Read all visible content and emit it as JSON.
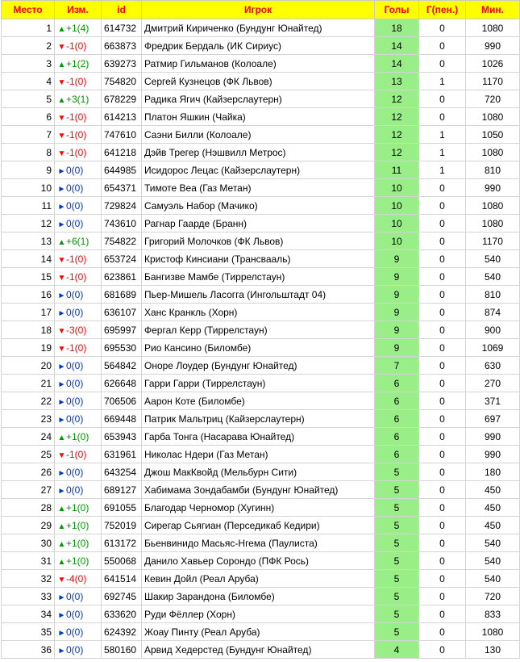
{
  "columns": {
    "place": "Место",
    "change": "Изм.",
    "id": "id",
    "player": "Игрок",
    "goals": "Голы",
    "pen": "Г(пен.)",
    "mins": "Мин."
  },
  "colors": {
    "header_bg": "#ffff00",
    "header_text": "#ff0000",
    "goals_bg": "#99ee88",
    "up": "#009900",
    "down": "#ff0000",
    "same": "#0033cc"
  },
  "rows": [
    {
      "place": "1",
      "dir": "up",
      "change": "+1(4)",
      "id": "614732",
      "player": "Дмитрий Кириченко (Бундунг Юнайтед)",
      "goals": "18",
      "pen": "0",
      "mins": "1080"
    },
    {
      "place": "2",
      "dir": "down",
      "change": "-1(0)",
      "id": "663873",
      "player": "Фредрик Бердаль (ИК Сириус)",
      "goals": "14",
      "pen": "0",
      "mins": "990"
    },
    {
      "place": "3",
      "dir": "up",
      "change": "+1(2)",
      "id": "639273",
      "player": "Ратмир Гильманов (Колоале)",
      "goals": "14",
      "pen": "0",
      "mins": "1026"
    },
    {
      "place": "4",
      "dir": "down",
      "change": "-1(0)",
      "id": "754820",
      "player": "Сергей Кузнецов (ФК Львов)",
      "goals": "13",
      "pen": "1",
      "mins": "1170"
    },
    {
      "place": "5",
      "dir": "up",
      "change": "+3(1)",
      "id": "678229",
      "player": "Радика Ягич (Кайзерслаутерн)",
      "goals": "12",
      "pen": "0",
      "mins": "720"
    },
    {
      "place": "6",
      "dir": "down",
      "change": "-1(0)",
      "id": "614213",
      "player": "Платон Яшкин (Чайка)",
      "goals": "12",
      "pen": "0",
      "mins": "1080"
    },
    {
      "place": "7",
      "dir": "down",
      "change": "-1(0)",
      "id": "747610",
      "player": "Саэни Билли (Колоале)",
      "goals": "12",
      "pen": "1",
      "mins": "1050"
    },
    {
      "place": "8",
      "dir": "down",
      "change": "-1(0)",
      "id": "641218",
      "player": "Дэйв Трегер (Нэшвилл Метрос)",
      "goals": "12",
      "pen": "1",
      "mins": "1080"
    },
    {
      "place": "9",
      "dir": "same",
      "change": "0(0)",
      "id": "644985",
      "player": "Исидорос Лецас (Кайзерслаутерн)",
      "goals": "11",
      "pen": "1",
      "mins": "810"
    },
    {
      "place": "10",
      "dir": "same",
      "change": "0(0)",
      "id": "654371",
      "player": "Тимоте Веа (Газ Метан)",
      "goals": "10",
      "pen": "0",
      "mins": "990"
    },
    {
      "place": "11",
      "dir": "same",
      "change": "0(0)",
      "id": "729824",
      "player": "Самуэль Набор (Мачико)",
      "goals": "10",
      "pen": "0",
      "mins": "1080"
    },
    {
      "place": "12",
      "dir": "same",
      "change": "0(0)",
      "id": "743610",
      "player": "Рагнар Гаарде (Бранн)",
      "goals": "10",
      "pen": "0",
      "mins": "1080"
    },
    {
      "place": "13",
      "dir": "up",
      "change": "+6(1)",
      "id": "754822",
      "player": "Григорий Молочков (ФК Львов)",
      "goals": "10",
      "pen": "0",
      "mins": "1170"
    },
    {
      "place": "14",
      "dir": "down",
      "change": "-1(0)",
      "id": "653724",
      "player": "Кристоф Кинсиани (Трансвааль)",
      "goals": "9",
      "pen": "0",
      "mins": "540"
    },
    {
      "place": "15",
      "dir": "down",
      "change": "-1(0)",
      "id": "623861",
      "player": "Бангизве Мамбе (Тиррелстаун)",
      "goals": "9",
      "pen": "0",
      "mins": "540"
    },
    {
      "place": "16",
      "dir": "same",
      "change": "0(0)",
      "id": "681689",
      "player": "Пьер-Мишель Ласогга (Ингольштадт 04)",
      "goals": "9",
      "pen": "0",
      "mins": "810"
    },
    {
      "place": "17",
      "dir": "same",
      "change": "0(0)",
      "id": "636107",
      "player": "Ханс Кранкль (Хорн)",
      "goals": "9",
      "pen": "0",
      "mins": "874"
    },
    {
      "place": "18",
      "dir": "down",
      "change": "-3(0)",
      "id": "695997",
      "player": "Фергал Керр (Тиррелстаун)",
      "goals": "9",
      "pen": "0",
      "mins": "900"
    },
    {
      "place": "19",
      "dir": "down",
      "change": "-1(0)",
      "id": "695530",
      "player": "Рио Кансино (Биломбе)",
      "goals": "9",
      "pen": "0",
      "mins": "1069"
    },
    {
      "place": "20",
      "dir": "same",
      "change": "0(0)",
      "id": "564842",
      "player": "Оноре Лоудер (Бундунг Юнайтед)",
      "goals": "7",
      "pen": "0",
      "mins": "630"
    },
    {
      "place": "21",
      "dir": "same",
      "change": "0(0)",
      "id": "626648",
      "player": "Гарри Гарри (Тиррелстаун)",
      "goals": "6",
      "pen": "0",
      "mins": "270"
    },
    {
      "place": "22",
      "dir": "same",
      "change": "0(0)",
      "id": "706506",
      "player": "Аарон Коте (Биломбе)",
      "goals": "6",
      "pen": "0",
      "mins": "371"
    },
    {
      "place": "23",
      "dir": "same",
      "change": "0(0)",
      "id": "669448",
      "player": "Патрик Мальтриц (Кайзерслаутерн)",
      "goals": "6",
      "pen": "0",
      "mins": "697"
    },
    {
      "place": "24",
      "dir": "up",
      "change": "+1(0)",
      "id": "653943",
      "player": "Гарба Тонга (Насарава Юнайтед)",
      "goals": "6",
      "pen": "0",
      "mins": "990"
    },
    {
      "place": "25",
      "dir": "down",
      "change": "-1(0)",
      "id": "631961",
      "player": "Николас Ндери (Газ Метан)",
      "goals": "6",
      "pen": "0",
      "mins": "990"
    },
    {
      "place": "26",
      "dir": "same",
      "change": "0(0)",
      "id": "643254",
      "player": "Джош МакКвойд (Мельбурн Сити)",
      "goals": "5",
      "pen": "0",
      "mins": "180"
    },
    {
      "place": "27",
      "dir": "same",
      "change": "0(0)",
      "id": "689127",
      "player": "Хабимама Зондабамби (Бундунг Юнайтед)",
      "goals": "5",
      "pen": "0",
      "mins": "450"
    },
    {
      "place": "28",
      "dir": "up",
      "change": "+1(0)",
      "id": "691055",
      "player": "Благодар Черномор (Хугинн)",
      "goals": "5",
      "pen": "0",
      "mins": "450"
    },
    {
      "place": "29",
      "dir": "up",
      "change": "+1(0)",
      "id": "752019",
      "player": "Сирегар Сьягиан (Перседикаб Кедири)",
      "goals": "5",
      "pen": "0",
      "mins": "450"
    },
    {
      "place": "30",
      "dir": "up",
      "change": "+1(0)",
      "id": "613172",
      "player": "Бьенвинидо Масьяс-Нгема (Паулиста)",
      "goals": "5",
      "pen": "0",
      "mins": "540"
    },
    {
      "place": "31",
      "dir": "up",
      "change": "+1(0)",
      "id": "550068",
      "player": "Данило Хавьер Сорондо (ПФК Рось)",
      "goals": "5",
      "pen": "0",
      "mins": "540"
    },
    {
      "place": "32",
      "dir": "down",
      "change": "-4(0)",
      "id": "641514",
      "player": "Кевин Дойл (Реал Аруба)",
      "goals": "5",
      "pen": "0",
      "mins": "540"
    },
    {
      "place": "33",
      "dir": "same",
      "change": "0(0)",
      "id": "692745",
      "player": "Шакир Зарандона (Биломбе)",
      "goals": "5",
      "pen": "0",
      "mins": "720"
    },
    {
      "place": "34",
      "dir": "same",
      "change": "0(0)",
      "id": "633620",
      "player": "Руди Фёллер (Хорн)",
      "goals": "5",
      "pen": "0",
      "mins": "833"
    },
    {
      "place": "35",
      "dir": "same",
      "change": "0(0)",
      "id": "624392",
      "player": "Жоау Пинту (Реал Аруба)",
      "goals": "5",
      "pen": "0",
      "mins": "1080"
    },
    {
      "place": "36",
      "dir": "same",
      "change": "0(0)",
      "id": "580160",
      "player": "Арвид Хедерстед (Бундунг Юнайтед)",
      "goals": "4",
      "pen": "0",
      "mins": "130"
    }
  ]
}
